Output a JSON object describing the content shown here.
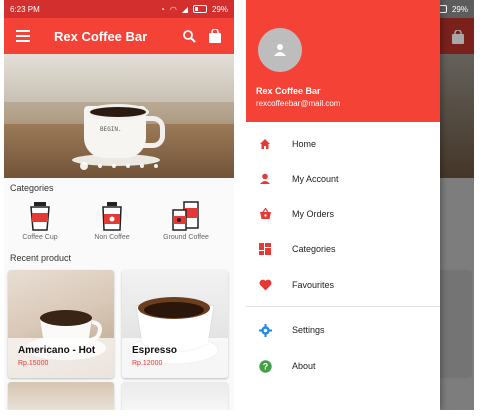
{
  "status": {
    "time": "6:23 PM",
    "battery": "29%"
  },
  "app": {
    "title": "Rex Coffee Bar"
  },
  "hero": {
    "cup_text": "BEGIN.",
    "slides": 6,
    "active_slide": 1
  },
  "categories": {
    "heading": "Categories",
    "items": [
      {
        "label": "Coffee Cup",
        "icon": "coffee-cup-icon"
      },
      {
        "label": "Non Coffee",
        "icon": "non-coffee-icon"
      },
      {
        "label": "Ground Coffee",
        "icon": "ground-coffee-icon"
      }
    ]
  },
  "recent": {
    "heading": "Recent product",
    "products": [
      {
        "name": "Americano - Hot",
        "price": "Rp.15000"
      },
      {
        "name": "Espresso",
        "price": "Rp.12000"
      }
    ]
  },
  "drawer": {
    "name": "Rex Coffee Bar",
    "email": "rexcoffeebar@mail.com",
    "items": [
      {
        "label": "Home",
        "icon": "home-icon"
      },
      {
        "label": "My Account",
        "icon": "person-icon"
      },
      {
        "label": "My Orders",
        "icon": "basket-icon"
      },
      {
        "label": "Categories",
        "icon": "dashboard-icon"
      },
      {
        "label": "Favourites",
        "icon": "heart-icon"
      },
      {
        "label": "Settings",
        "icon": "gear-icon"
      },
      {
        "label": "About",
        "icon": "help-icon"
      }
    ]
  },
  "colors": {
    "accent": "#f44336",
    "status_bar": "#d32f2f",
    "price": "#e53935",
    "settings_icon": "#1e88e5",
    "about_icon": "#43a047"
  }
}
